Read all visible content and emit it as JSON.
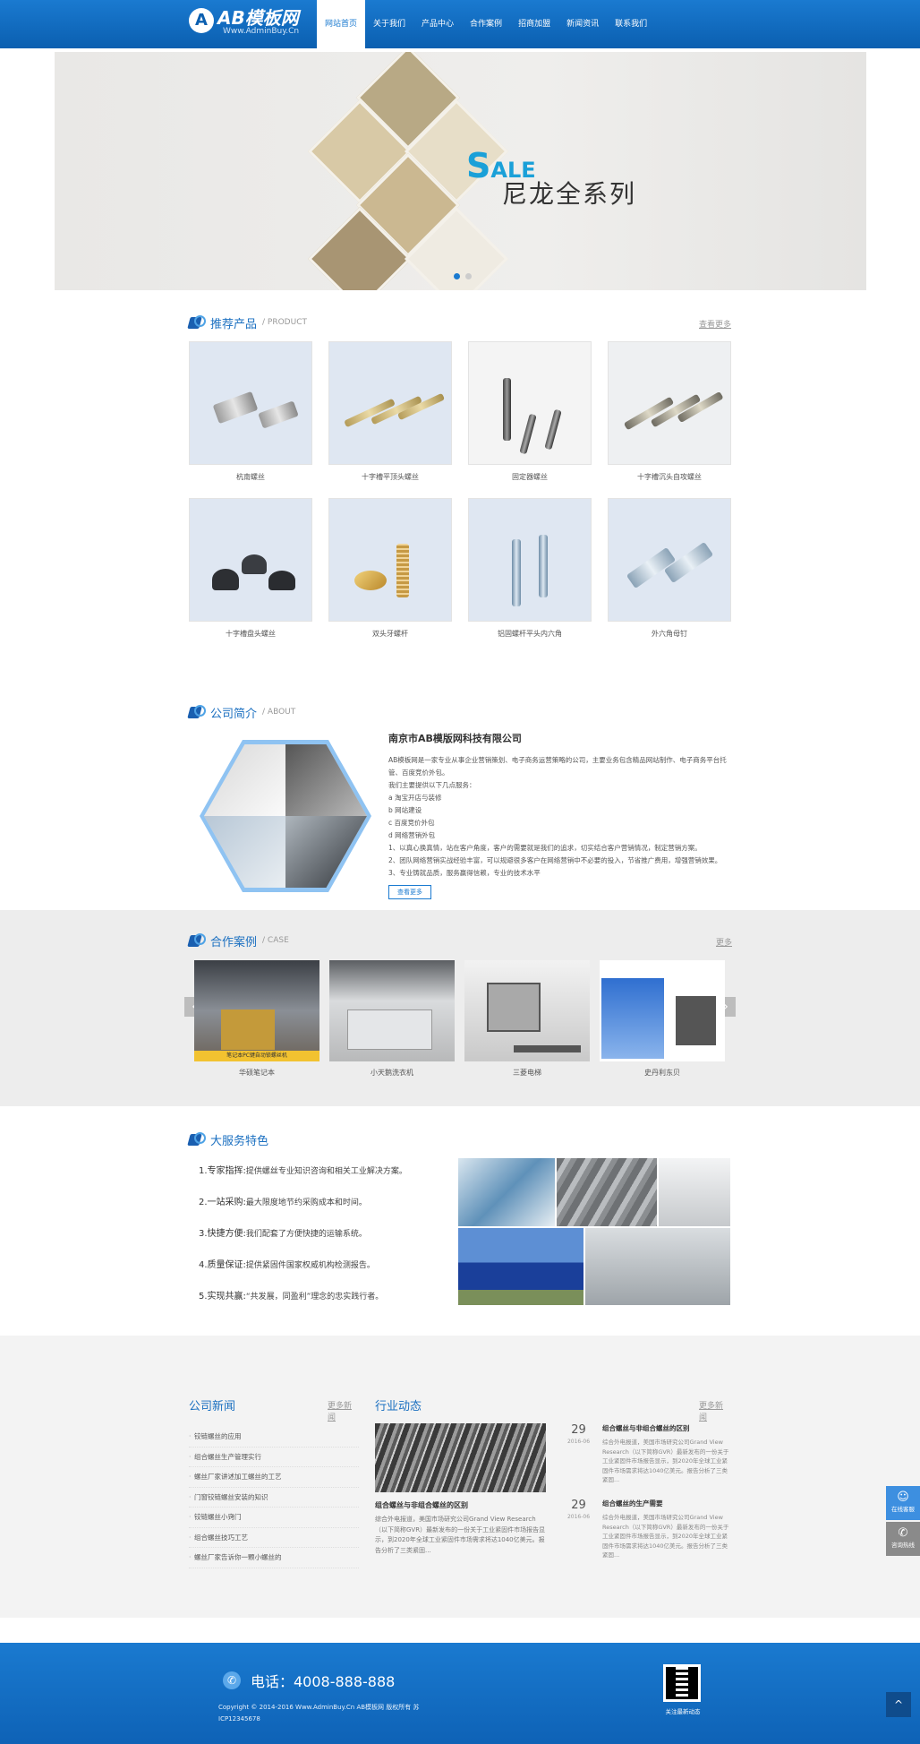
{
  "header": {
    "logo_mark": "A",
    "logo_name": "AB模板网",
    "logo_url": "Www.AdminBuy.Cn",
    "nav": [
      "网站首页",
      "关于我们",
      "产品中心",
      "合作案例",
      "招商加盟",
      "新闻资讯",
      "联系我们"
    ]
  },
  "banner": {
    "sale_big": "S",
    "sale_rest": "ALE",
    "title": "尼龙全系列"
  },
  "products": {
    "title": "推荐产品",
    "en": "/ PRODUCT",
    "more": "查看更多",
    "items": [
      "杭南螺丝",
      "十字槽平顶头螺丝",
      "固定器螺丝",
      "十字槽沉头自攻螺丝",
      "十字槽盘头螺丝",
      "双头牙螺杆",
      "铝固螺杆平头内六角",
      "外六角母钉"
    ]
  },
  "about": {
    "title": "公司简介",
    "en": "/ ABOUT",
    "company": "南京市AB模版网科技有限公司",
    "lines": [
      "AB模板网是一家专业从事企业营销策划、电子商务运营策略的公司，主要业务包含精品网站制作、电子商务平台托管、百度竞价外包。",
      "我们主要提供以下几点服务：",
      "a  淘宝开店与装修",
      "b  网站建设",
      "c  百度竞价外包",
      "d  网络营销外包",
      "1、以真心换真情，站在客户角度，客户的需要就是我们的追求，切实结合客户营销情况，制定营销方案。",
      "2、团队网络营销实战经验丰富，可以规避很多客户在网络营销中不必要的投入，节省推广费用，增强营销效果。",
      "3、专业铸就品质，服务赢得信赖，专业的技术水平"
    ],
    "more": "查看更多"
  },
  "cases": {
    "title": "合作案例",
    "en": "/ CASE",
    "more": "更多",
    "prev": "‹",
    "next": "›",
    "items": [
      "华硕笔记本",
      "小天鹅洗衣机",
      "三菱电梯",
      "史丹利东贝"
    ],
    "overlay_text": "笔记本PC键自动锁螺丝机"
  },
  "service": {
    "title": "大服务特色",
    "items": [
      {
        "n": "1.",
        "k": "专家指挥:",
        "v": "提供螺丝专业知识咨询和相关工业解决方案。"
      },
      {
        "n": "2.",
        "k": "一站采购:",
        "v": "最大限度地节约采购成本和时间。"
      },
      {
        "n": "3.",
        "k": "快捷方便:",
        "v": "我们配套了方便快捷的运输系统。"
      },
      {
        "n": "4.",
        "k": "质量保证:",
        "v": "提供紧固件国家权威机构检测报告。"
      },
      {
        "n": "5.",
        "k": "实现共赢:",
        "v": "“共发展，同盈利”理念的忠实践行者。"
      }
    ]
  },
  "news": {
    "company_title": "公司新闻",
    "company_more": "更多新闻",
    "company_items": [
      "铰链螺丝的应用",
      "组合螺丝生产管理实行",
      "螺丝厂家讲述加工螺丝的工艺",
      "门窗铰链螺丝安装的知识",
      "铰链螺丝小窍门",
      "组合螺丝技巧工艺",
      "螺丝厂家告诉你一颗小螺丝的"
    ],
    "industry_title": "行业动态",
    "industry_more": "更多新闻",
    "featured_title": "组合螺丝与非组合螺丝的区别",
    "featured_desc": "综合外电报道，美国市场研究公司Grand View Research（以下简称GVR）最新发布的一份关于工业紧固件市场报告显示，到2020年全球工业紧固件市场需求将达1040亿美元。报告分析了三类紧固...",
    "items": [
      {
        "day": "29",
        "ym": "2016-06",
        "title": "组合螺丝与非组合螺丝的区别",
        "desc": "综合外电报道，美国市场研究公司Grand View Research（以下简称GVR）最新发布的一份关于工业紧固件市场报告显示，到2020年全球工业紧固件市场需求将达1040亿美元。报告分析了三类紧固..."
      },
      {
        "day": "29",
        "ym": "2016-06",
        "title": "组合螺丝的生产需要",
        "desc": "综合外电报道，美国市场研究公司Grand View Research（以下简称GVR）最新发布的一份关于工业紧固件市场报告显示，到2020年全球工业紧固件市场需求将达1040亿美元。报告分析了三类紧固..."
      }
    ]
  },
  "footer": {
    "phone": "电话：4008-888-888",
    "copyright": "Copyright © 2014-2016 Www.AdminBuy.Cn AB模板网 版权所有   苏ICP12345678",
    "qr_caption": "关注最新动态"
  },
  "side": {
    "online": "在线客服",
    "hotline": "咨询热线",
    "top": "^"
  }
}
